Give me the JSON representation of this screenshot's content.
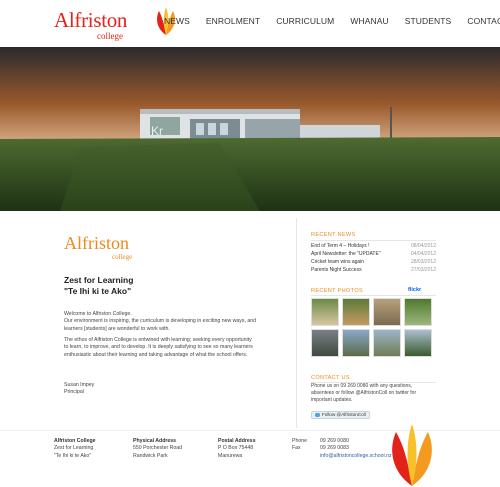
{
  "brand": {
    "name": "Alfriston",
    "sub": "college"
  },
  "nav": [
    {
      "label": "News"
    },
    {
      "label": "Enrolment"
    },
    {
      "label": "Curriculum"
    },
    {
      "label": "Whanau"
    },
    {
      "label": "Students"
    },
    {
      "label": "Contact"
    }
  ],
  "hero": {
    "building_sign": "Kr"
  },
  "intro": {
    "heading_line1": "Zest for Learning",
    "heading_line2": "\"Te Ihi ki te Ako\"",
    "p1_line1": "Welcome to Alfriston College.",
    "p1_line2": "Our environment is inspiring, the curriculum is developing in exciting new ways, and",
    "p1_line3": "learners [students] are wonderful to work with.",
    "p2_line1": "The ethos of Alfriston College is entwined with learning; seeking every opportunity",
    "p2_line2": "to learn, to improve, and to develop. It is deeply satisfying to see so many learners",
    "p2_line3": "enthusiastic about their learning and taking advantage of what the school offers.",
    "sign_name": "Susan Impey",
    "sign_role": "Principal"
  },
  "recent_news": {
    "title": "Recent News",
    "items": [
      {
        "title": "End of Term 4 – Holidays !",
        "date": "08/04/2012"
      },
      {
        "title": "April Newsletter: the \"UPDATE\"",
        "date": "04/04/2012"
      },
      {
        "title": "Cricket team wins again",
        "date": "28/03/2012"
      },
      {
        "title": "Parents Night Success",
        "date": "27/03/2012"
      }
    ]
  },
  "recent_photos": {
    "title": "Recent Photos",
    "flickr_a": "flickr",
    "flickr_b": "r",
    "flickr_suffix": ""
  },
  "contact_us": {
    "title": "Contact Us",
    "line1": "Phone us on 09 269 0080 with any questions,",
    "line2": "absentees or follow @AlfristonColl on twitter for",
    "line3": "important updates.",
    "follow_label": "Follow @AlfristonColl"
  },
  "footer": {
    "col1": {
      "line1": "Alfriston College",
      "line2": "Zest for Learning",
      "line3": "\"Te Ihi ki te Ako\""
    },
    "col2": {
      "title": "Physical Address",
      "line1": "550 Porchester Road",
      "line2": "Randwick Park"
    },
    "col3": {
      "title": "Postal Address",
      "line1": "P O Box 75448",
      "line2": "Manurewa"
    },
    "col4": {
      "phone_label": "Phone",
      "phone": "09 269 0080",
      "fax_label": "Fax",
      "fax": "09 269 0083",
      "email_label": "",
      "email": "info@alfristoncollege.school.nz"
    }
  },
  "colors": {
    "accent_red": "#e2231a",
    "accent_orange": "#e98b1e",
    "text": "#333333"
  }
}
